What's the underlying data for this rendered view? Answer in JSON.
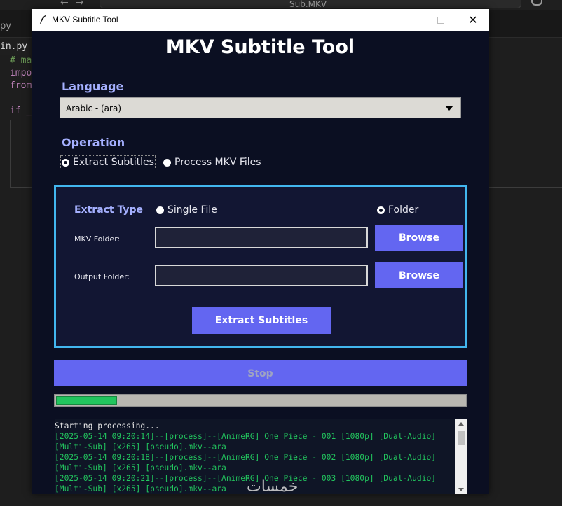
{
  "background": {
    "search_text": "Sub.MKV",
    "tab_label": "py",
    "active_tab": "in.py",
    "code_lines": [
      {
        "text": "# ma",
        "kind": "comment"
      },
      {
        "text": "impo",
        "kind": "keyword"
      },
      {
        "text": "from",
        "kind": "keyword"
      },
      {
        "text": "",
        "kind": "plain"
      },
      {
        "text": "if _",
        "kind": "keyword"
      }
    ]
  },
  "window": {
    "title": "MKV Subtitle Tool",
    "close_glyph": "✕"
  },
  "app": {
    "heading": "MKV Subtitle Tool",
    "language_label": "Language",
    "language_value": "Arabic - (ara)",
    "operation_label": "Operation",
    "operation_options": [
      {
        "label": "Extract Subtitles",
        "selected": true
      },
      {
        "label": "Process MKV Files",
        "selected": false
      }
    ],
    "extract_type_label": "Extract Type",
    "extract_type_options": [
      {
        "label": "Single File",
        "selected": false
      },
      {
        "label": "Folder",
        "selected": true
      }
    ],
    "mkv_folder_label": "MKV Folder:",
    "mkv_folder_value": "",
    "output_folder_label": "Output Folder:",
    "output_folder_value": "",
    "browse_label": "Browse",
    "extract_button": "Extract Subtitles",
    "stop_button": "Stop",
    "progress_fraction": 0.15
  },
  "log": {
    "lines": [
      "Starting processing...",
      "[2025-05-14 09:20:14]--[process]--[AnimeRG] One Piece - 001 [1080p] [Dual-Audio]",
      "[Multi-Sub] [x265] [pseudo].mkv--ara",
      "[2025-05-14 09:20:18]--[process]--[AnimeRG] One Piece - 002 [1080p] [Dual-Audio]",
      "[Multi-Sub] [x265] [pseudo].mkv--ara",
      "[2025-05-14 09:20:21]--[process]--[AnimeRG] One Piece - 003 [1080p] [Dual-Audio]",
      "[Multi-Sub] [x265] [pseudo].mkv--ara"
    ]
  },
  "watermark": "خمسات",
  "colors": {
    "accent": "#6366f1",
    "frame_border": "#42b6ee",
    "label": "#a5b0ff",
    "progress": "#22c55e",
    "window_bg": "#0b0f22"
  }
}
